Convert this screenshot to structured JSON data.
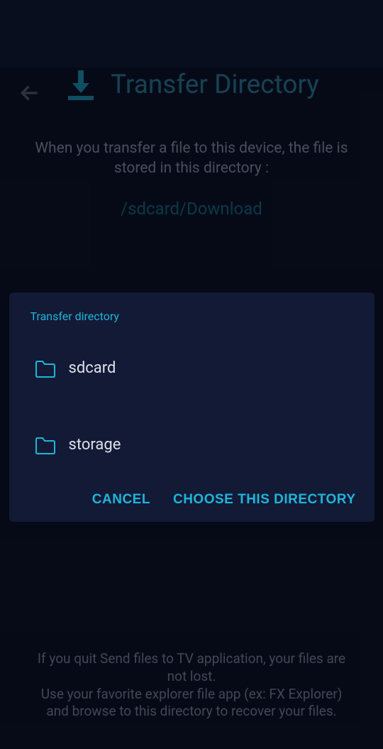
{
  "header": {
    "title": "Transfer Directory"
  },
  "description": "When you transfer a file to this device, the file is stored in this directory :",
  "path": "/sdcard/Download",
  "bottom": {
    "line1": "If you quit Send files to TV application, your files are not lost.",
    "line2": "Use your favorite explorer file app (ex: FX Explorer) and browse to this directory to recover your files."
  },
  "dialog": {
    "title": "Transfer directory",
    "folders": [
      {
        "name": "sdcard"
      },
      {
        "name": "storage"
      }
    ],
    "cancel": "CANCEL",
    "choose": "CHOOSE THIS DIRECTORY"
  }
}
